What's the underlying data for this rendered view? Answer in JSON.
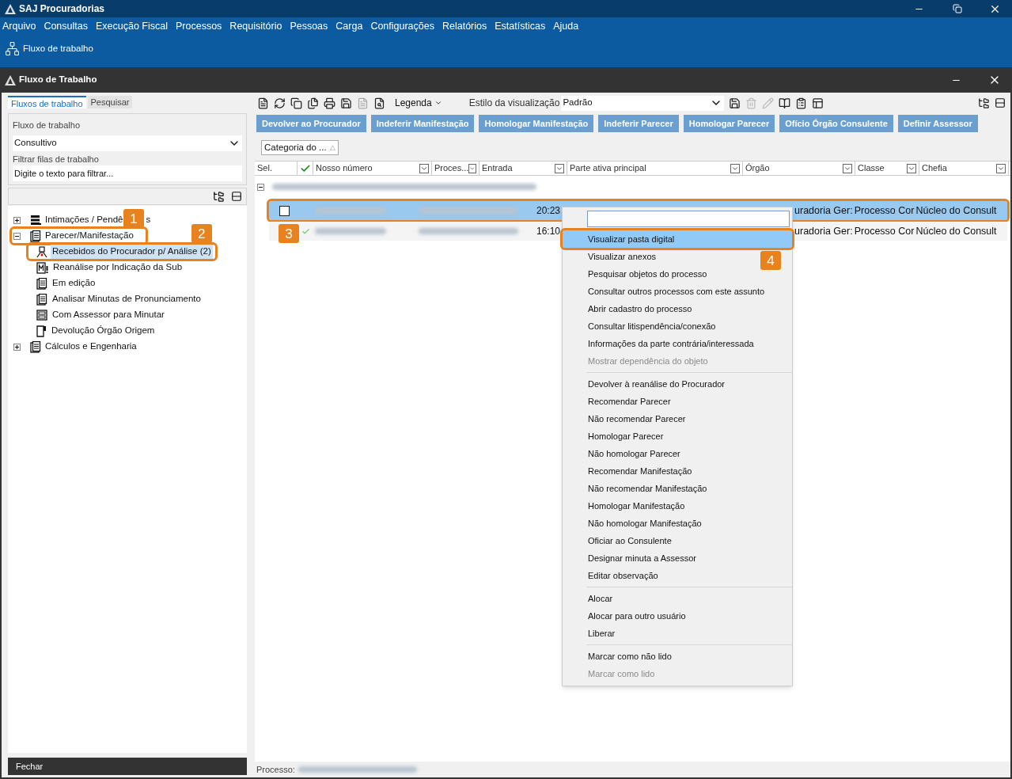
{
  "app_window": {
    "title": "SAJ Procuradorias",
    "menu": [
      "Arquivo",
      "Consultas",
      "Execução Fiscal",
      "Processos",
      "Requisitório",
      "Pessoas",
      "Carga",
      "Configurações",
      "Relatórios",
      "Estatísticas",
      "Ajuda"
    ],
    "ribbon_button": "Fluxo de trabalho"
  },
  "inner_window": {
    "title": "Fluxo de Trabalho"
  },
  "left_panel": {
    "tabs": [
      {
        "label": "Fluxos de trabalho",
        "selected": true
      },
      {
        "label": "Pesquisar",
        "selected": false
      }
    ],
    "workflow_label": "Fluxo de trabalho",
    "workflow_value": "Consultivo",
    "filter_label": "Filtrar filas de trabalho",
    "filter_placeholder": "Digite o texto para filtrar...",
    "tree": [
      {
        "label": "Intimações / Pendê",
        "label_tail": "s",
        "kind": "stack",
        "expanded": false,
        "selected": false
      },
      {
        "label": "Parecer/Manifestação",
        "kind": "clipboard",
        "expanded": true,
        "selected": false,
        "callout": "1",
        "children": [
          {
            "label": "Recebidos do Procurador p/  Análise (2)",
            "kind": "person",
            "selected": true,
            "callout": "2"
          },
          {
            "label": "Reanálise por Indicação da Sub",
            "kind": "flag",
            "selected": false
          },
          {
            "label": "Em edição",
            "kind": "clipboard",
            "selected": false
          },
          {
            "label": "Analisar Minutas de Pronunciamento",
            "kind": "clipboard",
            "selected": false
          },
          {
            "label": "Com Assessor para Minutar",
            "kind": "form",
            "selected": false
          },
          {
            "label": "Devolução Órgão Origem",
            "kind": "page",
            "selected": false
          }
        ]
      },
      {
        "label": "Cálculos e Engenharia",
        "kind": "clipboard",
        "expanded": false,
        "selected": false
      }
    ],
    "close_button": "Fechar"
  },
  "toolbar": {
    "legend": "Legenda",
    "view_style_label": "Estilo da visualização",
    "view_style_value": "Padrão"
  },
  "action_buttons": [
    "Devolver ao Procurador",
    "Indeferir Manifestação",
    "Homologar Manifestação",
    "Indeferir Parecer",
    "Homologar Parecer",
    "Ofício Órgão Consulente",
    "Definir Assessor"
  ],
  "group_chip": {
    "label": "Categoria do ...",
    "sort_mark": "△"
  },
  "table": {
    "columns": [
      "Sel.",
      "Nosso número",
      "Proces...",
      "Entrada",
      "Parte ativa principal",
      "Órgão",
      "Classe",
      "Chefia"
    ],
    "rows": [
      {
        "selected": true,
        "checked": false,
        "kind": "checkbox",
        "callout": "3",
        "time": "20:23",
        "column_5": "uradoria Ger:",
        "column_6": "Processo Cor",
        "column_7": "Núcleo do Consult"
      },
      {
        "selected": false,
        "checked": true,
        "kind": "tick",
        "time": "16:10",
        "column_5": "uradoria Ger:",
        "column_6": "Processo Cor",
        "column_7": "Núcleo do Consult"
      }
    ]
  },
  "context_menu": {
    "sections": [
      [
        {
          "label": "Visualizar pasta digital",
          "disabled": false,
          "selected": true,
          "callout": "4"
        },
        {
          "label": "Visualizar anexos",
          "disabled": false,
          "selected": false
        },
        {
          "label": "Pesquisar objetos do processo",
          "disabled": false,
          "selected": false
        },
        {
          "label": "Consultar outros processos com este assunto",
          "disabled": false,
          "selected": false
        },
        {
          "label": "Abrir cadastro do processo",
          "disabled": false,
          "selected": false
        },
        {
          "label": "Consultar litispendência/conexão",
          "disabled": false,
          "selected": false
        },
        {
          "label": "Informações da parte contrária/interessada",
          "disabled": false,
          "selected": false
        },
        {
          "label": "Mostrar dependência do objeto",
          "disabled": true,
          "selected": false
        }
      ],
      [
        {
          "label": "Devolver à reanálise do Procurador",
          "disabled": false,
          "selected": false
        },
        {
          "label": "Recomendar Parecer",
          "disabled": false,
          "selected": false
        },
        {
          "label": "Não recomendar Parecer",
          "disabled": false,
          "selected": false
        },
        {
          "label": "Homologar Parecer",
          "disabled": false,
          "selected": false
        },
        {
          "label": "Não homologar Parecer",
          "disabled": false,
          "selected": false
        },
        {
          "label": "Recomendar Manifestação",
          "disabled": false,
          "selected": false
        },
        {
          "label": "Não recomendar Manifestação",
          "disabled": false,
          "selected": false
        },
        {
          "label": "Homologar Manifestação",
          "disabled": false,
          "selected": false
        },
        {
          "label": "Não homologar Manifestação",
          "disabled": false,
          "selected": false
        },
        {
          "label": "Oficiar ao Consulente",
          "disabled": false,
          "selected": false
        },
        {
          "label": "Designar minuta a Assessor",
          "disabled": false,
          "selected": false
        },
        {
          "label": "Editar observação",
          "disabled": false,
          "selected": false
        }
      ],
      [
        {
          "label": "Alocar",
          "disabled": false,
          "selected": false
        },
        {
          "label": "Alocar para outro usuário",
          "disabled": false,
          "selected": false
        },
        {
          "label": "Liberar",
          "disabled": false,
          "selected": false
        }
      ],
      [
        {
          "label": "Marcar como não lido",
          "disabled": false,
          "selected": false
        },
        {
          "label": "Marcar como lido",
          "disabled": true,
          "selected": false
        }
      ]
    ]
  },
  "status_bar": {
    "label": "Processo:"
  }
}
